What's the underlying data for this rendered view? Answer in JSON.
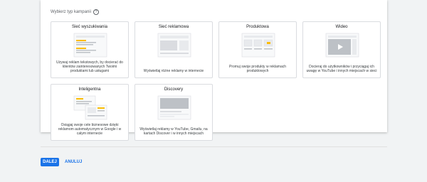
{
  "section_title": "Wybierz typ kampanii",
  "help_icon": "help-circle-icon",
  "cards": [
    {
      "title": "Sieć wyszukiwania",
      "desc": "Używaj reklam tekstowych, by docierać do klientów zainteresowanych Twoimi produktami lub usługami"
    },
    {
      "title": "Sieć reklamowa",
      "desc": "Wyświetlaj różne reklamy w internecie"
    },
    {
      "title": "Produktowa",
      "desc": "Promuj swoje produkty w reklamach produktowych"
    },
    {
      "title": "Wideo",
      "desc": "Docieraj do użytkowników i przyciągaj ich uwagę w YouTube i innych miejscach w sieci"
    },
    {
      "title": "Inteligentna",
      "desc": "Osiągaj swoje cele biznesowe dzięki reklamom automatycznym w Google i w całym internecie"
    },
    {
      "title": "Discovery",
      "desc": "Wyświetlaj reklamy w YouTube, Gmailu, na kartach Discover i w innych miejscach"
    }
  ],
  "buttons": {
    "next": "DALEJ",
    "cancel": "ANULUJ"
  },
  "colors": {
    "primary": "#1a73e8",
    "accent_yellow": "#fbbc04"
  }
}
